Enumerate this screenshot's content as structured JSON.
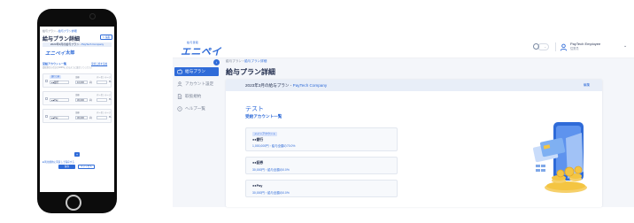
{
  "phone": {
    "breadcrumb": {
      "parent": "給与プラン",
      "sep": " › ",
      "current": "給与プラン詳細"
    },
    "title": "給与プラン詳細",
    "edit_button": "編集",
    "plan": {
      "name": "2023年3月の給与プラン",
      "sep": " - ",
      "company": "PayTech Company"
    },
    "logo": "エニペイ",
    "employee_name": "太郎",
    "section": "受給アカウント一覧",
    "section_link": "受給口座を追加",
    "note": "受給割合の合計が100%になるように設定してください",
    "cards": [
      {
        "tag": "銀行口座",
        "field1_label": "金額",
        "field2_label": "パーセンテージ",
        "select": "●●銀行",
        "amount": "10,000",
        "unit": "円",
        "pct": "%"
      },
      {
        "tag": "",
        "field1_label": "金額",
        "field2_label": "パーセンテージ",
        "select": "●●Pay",
        "amount": "30,000",
        "unit": "円",
        "pct": "%"
      },
      {
        "tag": "",
        "field1_label": "金額",
        "field2_label": "パーセンテージ",
        "select": "●●Pay",
        "amount": "30,000",
        "unit": "円",
        "pct": "%"
      }
    ],
    "add_button": "+",
    "consent": "■ 利用規約に同意して保存する",
    "save_button": "保存",
    "cancel_button": "キャンセル"
  },
  "desktop": {
    "logo_small": "給与受取",
    "logo": "エニペイ",
    "header_dropdown": "⌄",
    "user": {
      "name": "PayTech Employee",
      "role": "従業員"
    },
    "sidebar": {
      "toggle": "‹",
      "items": [
        {
          "label": "給与プラン",
          "icon": "wallet-icon",
          "active": true
        },
        {
          "label": "アカウント設定",
          "icon": "user-icon",
          "active": false
        },
        {
          "label": "取扱規約",
          "icon": "document-icon",
          "active": false
        },
        {
          "label": "ヘルプ一覧",
          "icon": "help-icon",
          "active": false
        }
      ]
    },
    "breadcrumb": {
      "parent": "給与プラン",
      "sep": " › ",
      "current": "給与プラン詳細"
    },
    "title": "給与プラン詳細",
    "plan": {
      "name": "2023年3月の給与プラン",
      "sep": " - ",
      "company": "PayTech Company"
    },
    "edit_link": "編集",
    "account_title": "テスト",
    "section": "受給アカウント一覧",
    "cards": [
      {
        "tag": "メインアカウント",
        "name": "●●銀行",
        "amount": "1,000,000円・給与全額の70.0%"
      },
      {
        "tag": "",
        "name": "●●証券",
        "amount": "30,000円・給与全額の0.0%"
      },
      {
        "tag": "",
        "name": "●●Pay",
        "amount": "30,000円・給与全額の0.0%"
      }
    ]
  },
  "colors": {
    "accent": "#2f6bd8",
    "text": "#1e2a4a",
    "muted": "#7a8395",
    "panel_bg": "#f4f6fa"
  }
}
